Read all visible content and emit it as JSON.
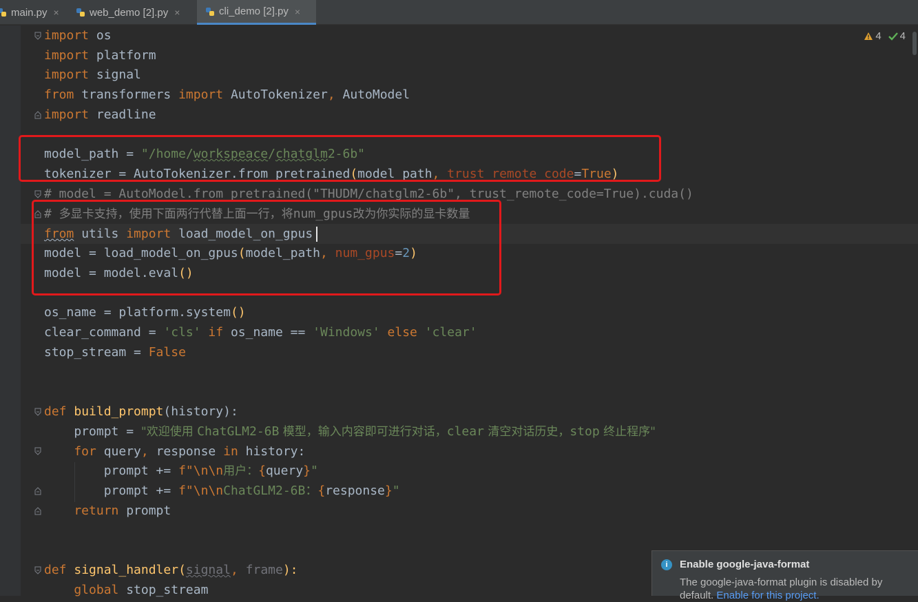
{
  "tabs": [
    {
      "label": "main.py",
      "icon": "python-file-icon",
      "active": false
    },
    {
      "label": "web_demo [2].py",
      "icon": "python-file-icon",
      "active": false
    },
    {
      "label": "cli_demo [2].py",
      "icon": "python-file-icon",
      "active": true
    }
  ],
  "tab_close_glyph": "×",
  "inspections": {
    "warnings": "4",
    "typos": "4"
  },
  "code": {
    "l1_kw": "import",
    "l1_rest": " os",
    "l2_kw": "import",
    "l2_rest": " platform",
    "l3_kw": "import",
    "l3_rest": " signal",
    "l4_kw1": "from",
    "l4_mid": " transformers ",
    "l4_kw2": "import",
    "l4_rest": " AutoTokenizer",
    "l4_comma": ",",
    "l4_end": " AutoModel",
    "l5_kw": "import",
    "l5_rest": " readline",
    "l7_var": "model_path = ",
    "l7_q1": "\"/home/",
    "l7_ul": "workspeace",
    "l7_mid": "/",
    "l7_ul2": "chatglm",
    "l7_q2": "2-6b\"",
    "l8_a": "tokenizer = AutoTokenizer.from_pretrained",
    "l8_p": "(",
    "l8_b": "model_path",
    "l8_comma": ", ",
    "l8_param": "trust_remote_code",
    "l8_eq": "=",
    "l8_kw": "True",
    "l8_close": ")",
    "l9": "# model = AutoModel.from_pretrained(\"THUDM/chatglm2-6b\", trust_remote_code=True).cuda()",
    "l10_hash": "# ",
    "l10_cjk1": "多显卡支持，使用下面两行代替上面一行，将",
    "l10_mono": "num_gpus",
    "l10_cjk2": "改为你实际的显卡数量",
    "l11_kw1": "from",
    "l11_mid": " utils ",
    "l11_kw2": "import",
    "l11_rest": " load_model_on_gpus",
    "l12_a": "model = load_model_on_gpus",
    "l12_p": "(",
    "l12_b": "model_path",
    "l12_comma": ", ",
    "l12_param": "num_gpus",
    "l12_eq": "=",
    "l12_num": "2",
    "l12_close": ")",
    "l13_a": "model = model.eval",
    "l13_p": "()",
    "l15_a": "os_name = platform.system",
    "l15_p": "()",
    "l16_a": "clear_command = ",
    "l16_s1": "'cls'",
    "l16_kw1": " if ",
    "l16_b": "os_name == ",
    "l16_s2": "'Windows'",
    "l16_kw2": " else ",
    "l16_s3": "'clear'",
    "l17_a": "stop_stream = ",
    "l17_kw": "False",
    "l20_kw": "def",
    "l20_fn": " build_prompt",
    "l20_rest": "(history):",
    "l21_a": "    prompt = ",
    "l21_s1": "\"欢迎使用 ",
    "l21_s2": "ChatGLM2-6B",
    "l21_s3": " 模型，输入内容即可进行对话，",
    "l21_s4": "clear",
    "l21_s5": " 清空对话历史，",
    "l21_s6": "stop",
    "l21_s7": " 终止程序\"",
    "l22_kw": "    for",
    "l22_a": " query",
    "l22_comma": ",",
    "l22_b": " response ",
    "l22_kw2": "in",
    "l22_c": " history:",
    "l23_a": "        prompt += ",
    "l23_f": "f\"",
    "l23_esc": "\\n\\n",
    "l23_cjk": "用户：",
    "l23_br1": "{",
    "l23_var": "query",
    "l23_br2": "}",
    "l23_q": "\"",
    "l24_a": "        prompt += ",
    "l24_f": "f\"",
    "l24_esc": "\\n\\n",
    "l24_s": "ChatGLM2-6B：",
    "l24_br1": "{",
    "l24_var": "response",
    "l24_br2": "}",
    "l24_q": "\"",
    "l25_kw": "    return",
    "l25_rest": " prompt",
    "l28_kw": "def",
    "l28_fn": " signal_handler",
    "l28_p": "(",
    "l28_a": "signal",
    "l28_comma": ", ",
    "l28_b": "frame",
    "l28_close": "):",
    "l29_kw": "    global",
    "l29_rest": " stop_stream"
  },
  "notification": {
    "title": "Enable google-java-format",
    "body": "The google-java-format plugin is disabled by default. ",
    "link": "Enable for this project."
  },
  "colors": {
    "accent": "#4a88c7",
    "annotation": "#e1191b"
  }
}
